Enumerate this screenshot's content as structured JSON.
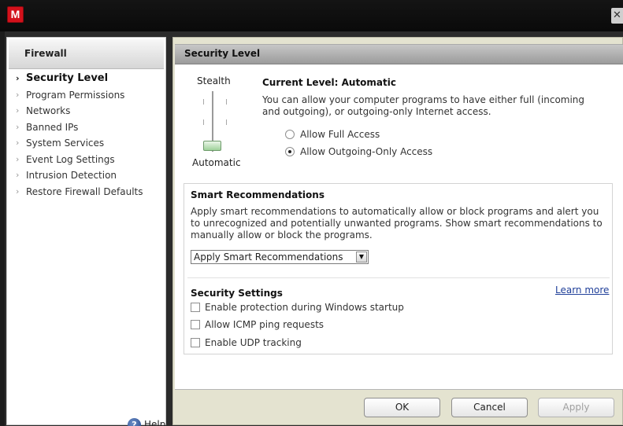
{
  "window": {
    "logo_letter": "M",
    "close_glyph": "✕"
  },
  "sidebar": {
    "title": "Firewall",
    "chevron": "›",
    "items": [
      {
        "label": "Security Level",
        "active": true
      },
      {
        "label": "Program Permissions"
      },
      {
        "label": "Networks"
      },
      {
        "label": "Banned IPs"
      },
      {
        "label": "System Services"
      },
      {
        "label": "Event Log Settings"
      },
      {
        "label": "Intrusion Detection"
      },
      {
        "label": "Restore Firewall Defaults"
      }
    ],
    "help_label": "Help",
    "help_glyph": "?"
  },
  "main": {
    "title": "Security Level",
    "slider": {
      "top_label": "Stealth",
      "bottom_label": "Automatic",
      "value": "Automatic"
    },
    "current_level_title": "Current Level: Automatic",
    "current_level_desc": "You can allow your computer programs to have either full (incoming and outgoing), or outgoing-only Internet access.",
    "radios": [
      {
        "label": "Allow Full Access",
        "checked": false
      },
      {
        "label": "Allow Outgoing-Only Access",
        "checked": true
      }
    ],
    "smart": {
      "title": "Smart Recommendations",
      "desc": "Apply smart recommendations to automatically allow or block programs and alert you to unrecognized and potentially unwanted programs. Show smart recommendations to manually allow or block the programs.",
      "select_value": "Apply Smart Recommendations",
      "arrow_glyph": "▼"
    },
    "security_settings": {
      "title": "Security Settings",
      "learn_more": "Learn more",
      "checks": [
        {
          "label": "Enable protection during Windows startup",
          "checked": false
        },
        {
          "label": "Allow ICMP ping requests",
          "checked": false
        },
        {
          "label": "Enable UDP tracking",
          "checked": false
        }
      ]
    }
  },
  "buttons": {
    "ok": "OK",
    "cancel": "Cancel",
    "apply": "Apply"
  },
  "colors": {
    "panel_bg": "#e4e3d0",
    "brand_red": "#d3111b",
    "link": "#1f3f99"
  }
}
